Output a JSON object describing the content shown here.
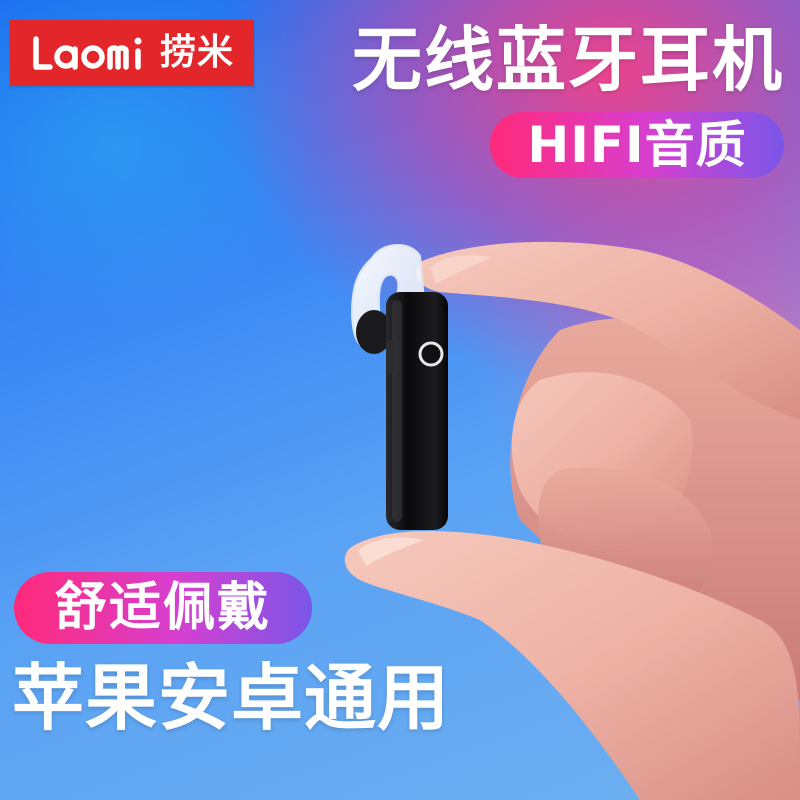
{
  "brand": {
    "latin_name": "LAOMI",
    "chinese_name": "捞米",
    "color": "#e3262a"
  },
  "headline": "无线蓝牙耳机",
  "badge_top": "HIFI音质",
  "badge_bottom": "舒适佩戴",
  "compatibility": "苹果安卓通用",
  "accent_gradient": [
    "#ff2a7a",
    "#d63fd0",
    "#7a56e8"
  ],
  "scene": {
    "product": "single-ear bluetooth headset",
    "product_color": "#0c0c0e",
    "background_colors": [
      "#1e6ff0",
      "#5aa2f4",
      "#ff3c82"
    ]
  }
}
